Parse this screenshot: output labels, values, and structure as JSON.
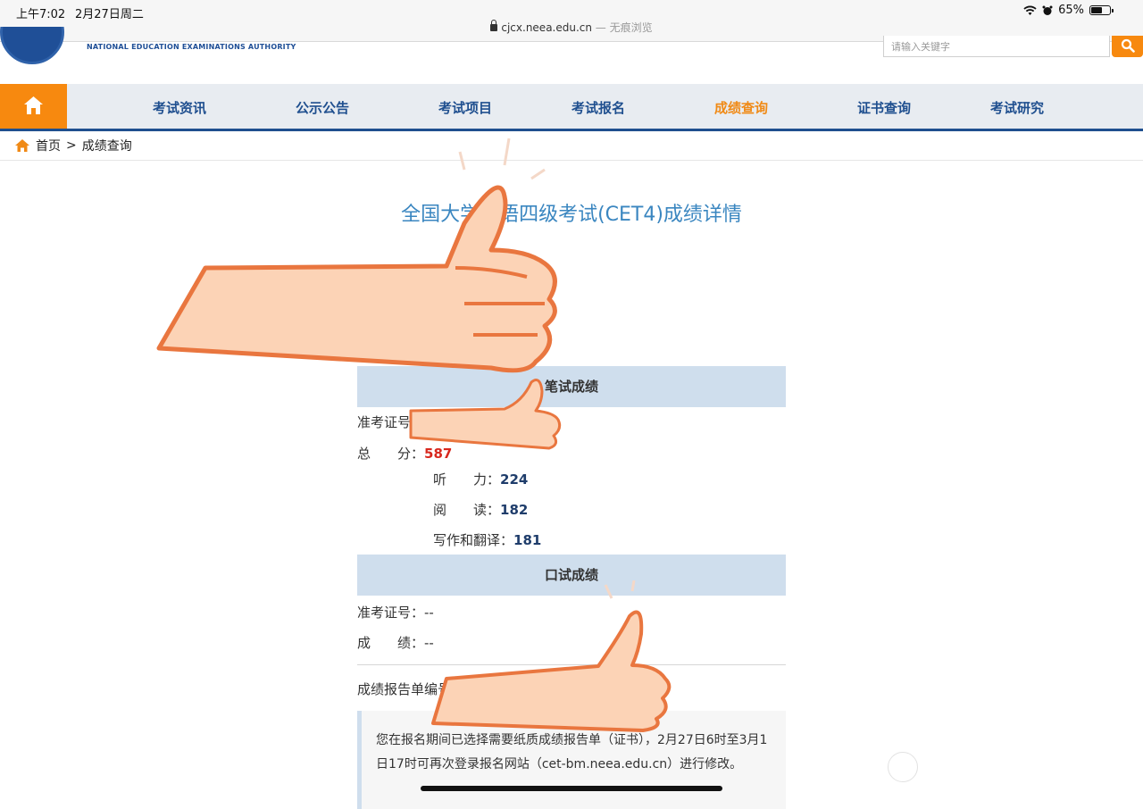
{
  "status_bar": {
    "time": "上午7:02",
    "date": "2月27日周二",
    "battery": "65%",
    "battery_level": 0.65,
    "url_host": "cjcx.neea.edu.cn",
    "url_mode": " — 无痕浏览"
  },
  "header": {
    "org_english": "NATIONAL EDUCATION EXAMINATIONS AUTHORITY",
    "search_placeholder": "请输入关键字",
    "accent_color": "#f7890f",
    "brand_color": "#1f4f8f"
  },
  "nav": {
    "items": [
      {
        "label": "考试资讯"
      },
      {
        "label": "公示公告"
      },
      {
        "label": "考试项目"
      },
      {
        "label": "考试报名"
      },
      {
        "label": "成绩查询",
        "active": true
      },
      {
        "label": "证书查询"
      },
      {
        "label": "考试研究"
      }
    ]
  },
  "breadcrumb": {
    "home": "首页",
    "sep": ">",
    "current": "成绩查询"
  },
  "title": "全国大学英语四级考试(CET4)成绩详情",
  "written": {
    "header": "笔试成绩",
    "id_label": "准考证号",
    "total_label": "总　　分：",
    "total": "587",
    "listening_label": "听　　力：",
    "listening": "224",
    "reading_label": "阅　　读：",
    "reading": "182",
    "writing_label": "写作和翻译：",
    "writing": "181"
  },
  "oral": {
    "header": "口试成绩",
    "id_label": "准考证号：",
    "id_value": "--",
    "score_label": "成　　绩：",
    "score_value": "--"
  },
  "report": {
    "label": "成绩报告单编号"
  },
  "notice": {
    "text": "您在报名期间已选择需要纸质成绩报告单（证书），2月27日6时至3月1日17时可再次登录报名网站（cet-bm.neea.edu.cn）进行修改。"
  }
}
